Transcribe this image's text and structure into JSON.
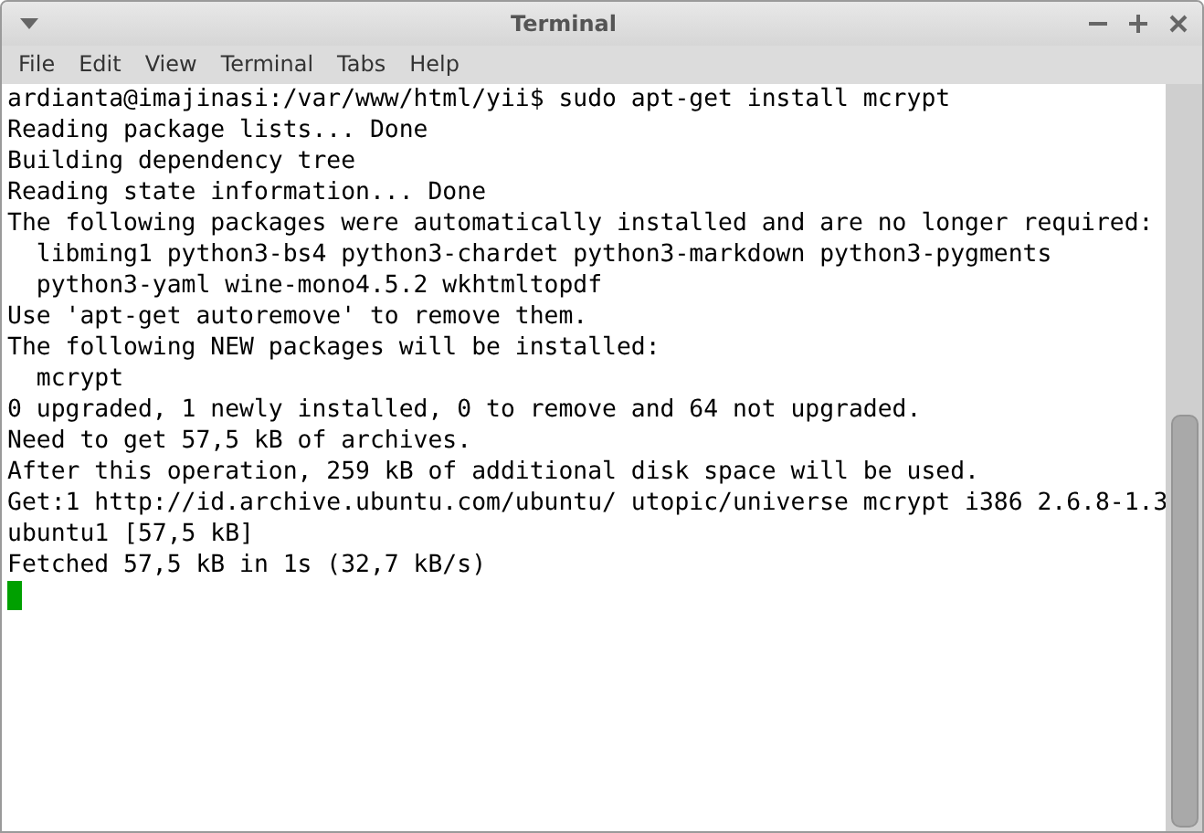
{
  "window": {
    "title": "Terminal"
  },
  "menu": [
    "File",
    "Edit",
    "View",
    "Terminal",
    "Tabs",
    "Help"
  ],
  "terminal": {
    "lines": [
      "ardianta@imajinasi:/var/www/html/yii$ sudo apt-get install mcrypt",
      "Reading package lists... Done",
      "Building dependency tree",
      "Reading state information... Done",
      "The following packages were automatically installed and are no longer required:",
      "  libming1 python3-bs4 python3-chardet python3-markdown python3-pygments",
      "  python3-yaml wine-mono4.5.2 wkhtmltopdf",
      "Use 'apt-get autoremove' to remove them.",
      "The following NEW packages will be installed:",
      "  mcrypt",
      "0 upgraded, 1 newly installed, 0 to remove and 64 not upgraded.",
      "Need to get 57,5 kB of archives.",
      "After this operation, 259 kB of additional disk space will be used.",
      "Get:1 http://id.archive.ubuntu.com/ubuntu/ utopic/universe mcrypt i386 2.6.8-1.3",
      "ubuntu1 [57,5 kB]",
      "Fetched 57,5 kB in 1s (32,7 kB/s)"
    ]
  }
}
